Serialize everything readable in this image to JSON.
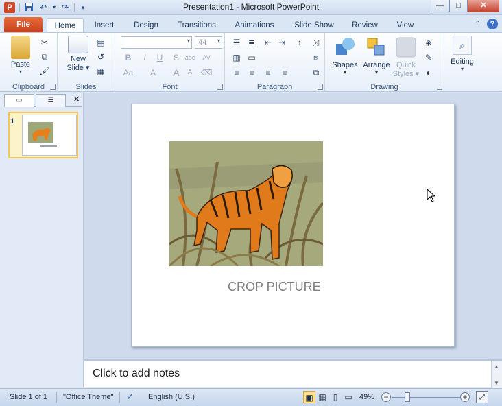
{
  "window": {
    "title": "Presentation1  -  Microsoft PowerPoint",
    "app_icon_letter": "P"
  },
  "tabs": [
    {
      "label": "File"
    },
    {
      "label": "Home"
    },
    {
      "label": "Insert"
    },
    {
      "label": "Design"
    },
    {
      "label": "Transitions"
    },
    {
      "label": "Animations"
    },
    {
      "label": "Slide Show"
    },
    {
      "label": "Review"
    },
    {
      "label": "View"
    }
  ],
  "ribbon": {
    "groups": {
      "clipboard": "Clipboard",
      "slides": "Slides",
      "font": "Font",
      "paragraph": "Paragraph",
      "drawing": "Drawing"
    },
    "paste_label": "Paste",
    "new_slide_label_1": "New",
    "new_slide_label_2": "Slide",
    "font_size": "44",
    "shapes_label": "Shapes",
    "arrange_label": "Arrange",
    "quick_styles_label_1": "Quick",
    "quick_styles_label_2": "Styles",
    "editing_label": "Editing",
    "font_buttons": [
      "B",
      "I",
      "U",
      "S",
      "abc",
      "AV",
      "Aa",
      "A",
      "A",
      "A"
    ]
  },
  "left_pane": {
    "slide_number": "1"
  },
  "slide": {
    "caption": "CROP PICTURE"
  },
  "notes": {
    "placeholder": "Click to add notes"
  },
  "status": {
    "slide_info": "Slide 1 of 1",
    "theme": "\"Office Theme\"",
    "language": "English (U.S.)",
    "zoom": "49%"
  },
  "colors": {
    "file_tab": "#d24726",
    "accent": "#3e73c9",
    "selection": "#f3c75b"
  }
}
